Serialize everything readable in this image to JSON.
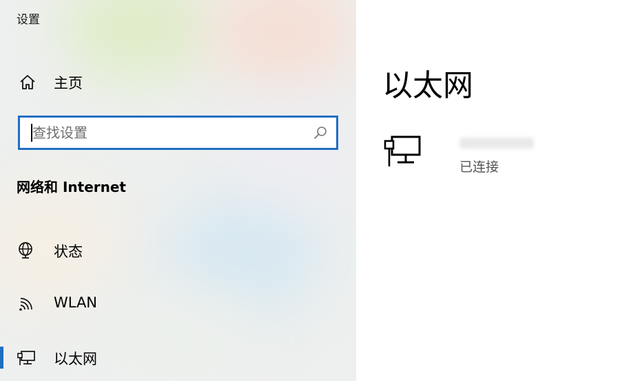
{
  "window": {
    "title": "设置"
  },
  "sidebar": {
    "home": {
      "label": "主页",
      "icon": "home-icon"
    },
    "search": {
      "placeholder": "查找设置",
      "value": "",
      "icon": "search-icon"
    },
    "section_title": "网络和 Internet",
    "items": [
      {
        "label": "状态",
        "icon": "globe-status-icon",
        "active": false
      },
      {
        "label": "WLAN",
        "icon": "wifi-icon",
        "active": false
      },
      {
        "label": "以太网",
        "icon": "ethernet-icon",
        "active": true
      }
    ]
  },
  "main": {
    "title": "以太网",
    "connection": {
      "icon": "ethernet-computer-icon",
      "name": "",
      "status": "已连接"
    }
  },
  "colors": {
    "accent": "#1e6fc2",
    "content_bg": "#ffffff"
  }
}
